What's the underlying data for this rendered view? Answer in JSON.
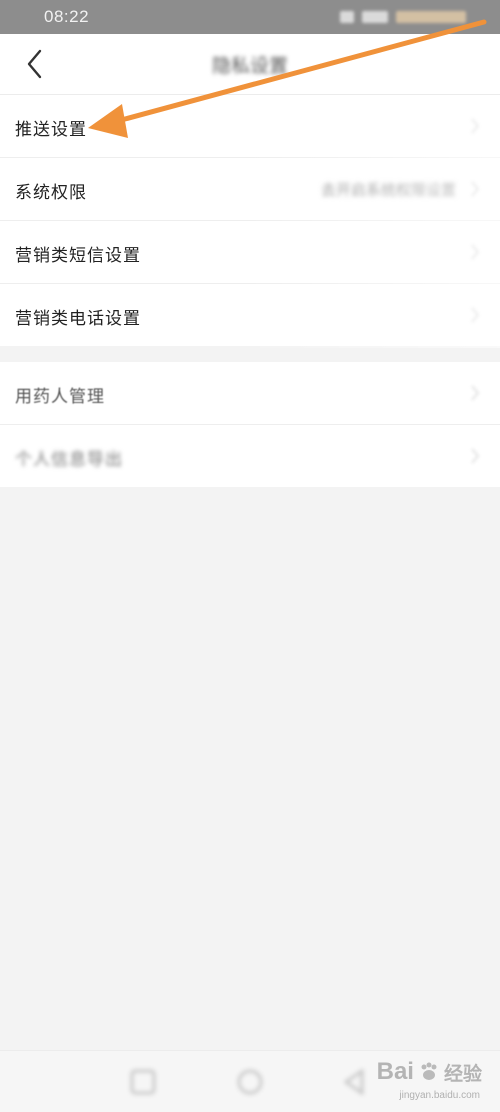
{
  "status_bar": {
    "time": "08:22"
  },
  "header": {
    "title": "隐私设置",
    "back_icon": "chevron-left-icon"
  },
  "groups": [
    {
      "items": [
        {
          "label": "推送设置",
          "value": ""
        },
        {
          "label": "系统权限",
          "value": "去开启系统权限设置"
        },
        {
          "label": "营销类短信设置",
          "value": ""
        },
        {
          "label": "营销类电话设置",
          "value": ""
        }
      ]
    },
    {
      "items": [
        {
          "label": "用药人管理",
          "value": ""
        },
        {
          "label": "个人信息导出",
          "value": ""
        }
      ]
    }
  ],
  "annotation": {
    "arrow_color": "#f0923a"
  },
  "watermark": {
    "brand": "Bai",
    "brand_suffix": "经验",
    "site": "jingyan.baidu.com"
  }
}
